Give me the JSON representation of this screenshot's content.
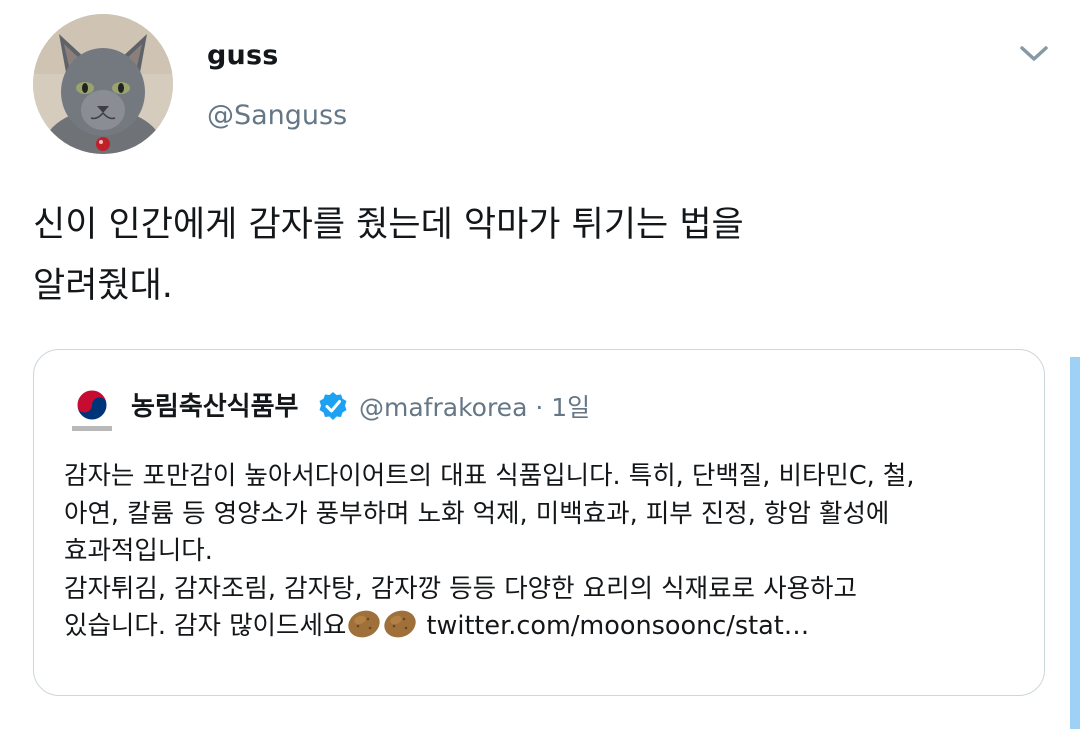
{
  "tweet": {
    "display_name": "guss",
    "handle": "@Sanguss",
    "text_line1": "신이 인간에게 감자를 줬는데 악마가 튀기는 법을",
    "text_line2": "알려줬대."
  },
  "quoted_tweet": {
    "display_name": "농림축산식품부",
    "handle": "@mafrakorea",
    "time": " · 1일",
    "logo_caption": "농림축산식품부",
    "body_line1": "감자는 포만감이 높아서다이어트의 대표 식품입니다. 특히, 단백질, 비타민C, 철,",
    "body_line2": "아연, 칼륨 등 영양소가 풍부하며 노화 억제, 미백효과, 피부 진정, 항암 활성에",
    "body_line3": "효과적입니다.",
    "body_line4": "감자튀김, 감자조림, 감자탕, 감자깡 등등 다양한 요리의 식재료로 사용하고",
    "body_line5_text": "있습니다. 감자 많이드세요",
    "body_link": "twitter.com/moonsoonc/stat…"
  },
  "icons": {
    "more": "chevron-down-icon",
    "verified": "verified-badge-icon",
    "emoji": "potato-emoji"
  },
  "colors": {
    "secondary_text": "#657786",
    "verified_blue": "#1da1f2",
    "card_border": "#ccd6dd"
  }
}
